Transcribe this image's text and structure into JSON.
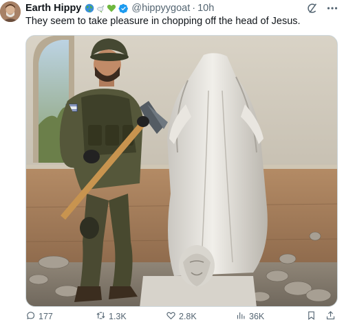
{
  "post": {
    "author_name": "Earth Hippy",
    "handle": "@hippyygoat",
    "separator": "·",
    "time": "10h",
    "text": "They seem to take pleasure in chopping off the head of Jesus."
  },
  "badges": [
    "globe-emoji",
    "dove-emoji",
    "green-heart-emoji",
    "verified-badge"
  ],
  "header_icons": [
    "grok-icon",
    "more-icon"
  ],
  "actions": {
    "replies": "177",
    "reposts": "1.3K",
    "likes": "2.8K",
    "views": "36K"
  },
  "colors": {
    "text": "#0f1419",
    "secondary": "#536471",
    "verified": "#1d9bf0",
    "border": "#cfd9de"
  }
}
